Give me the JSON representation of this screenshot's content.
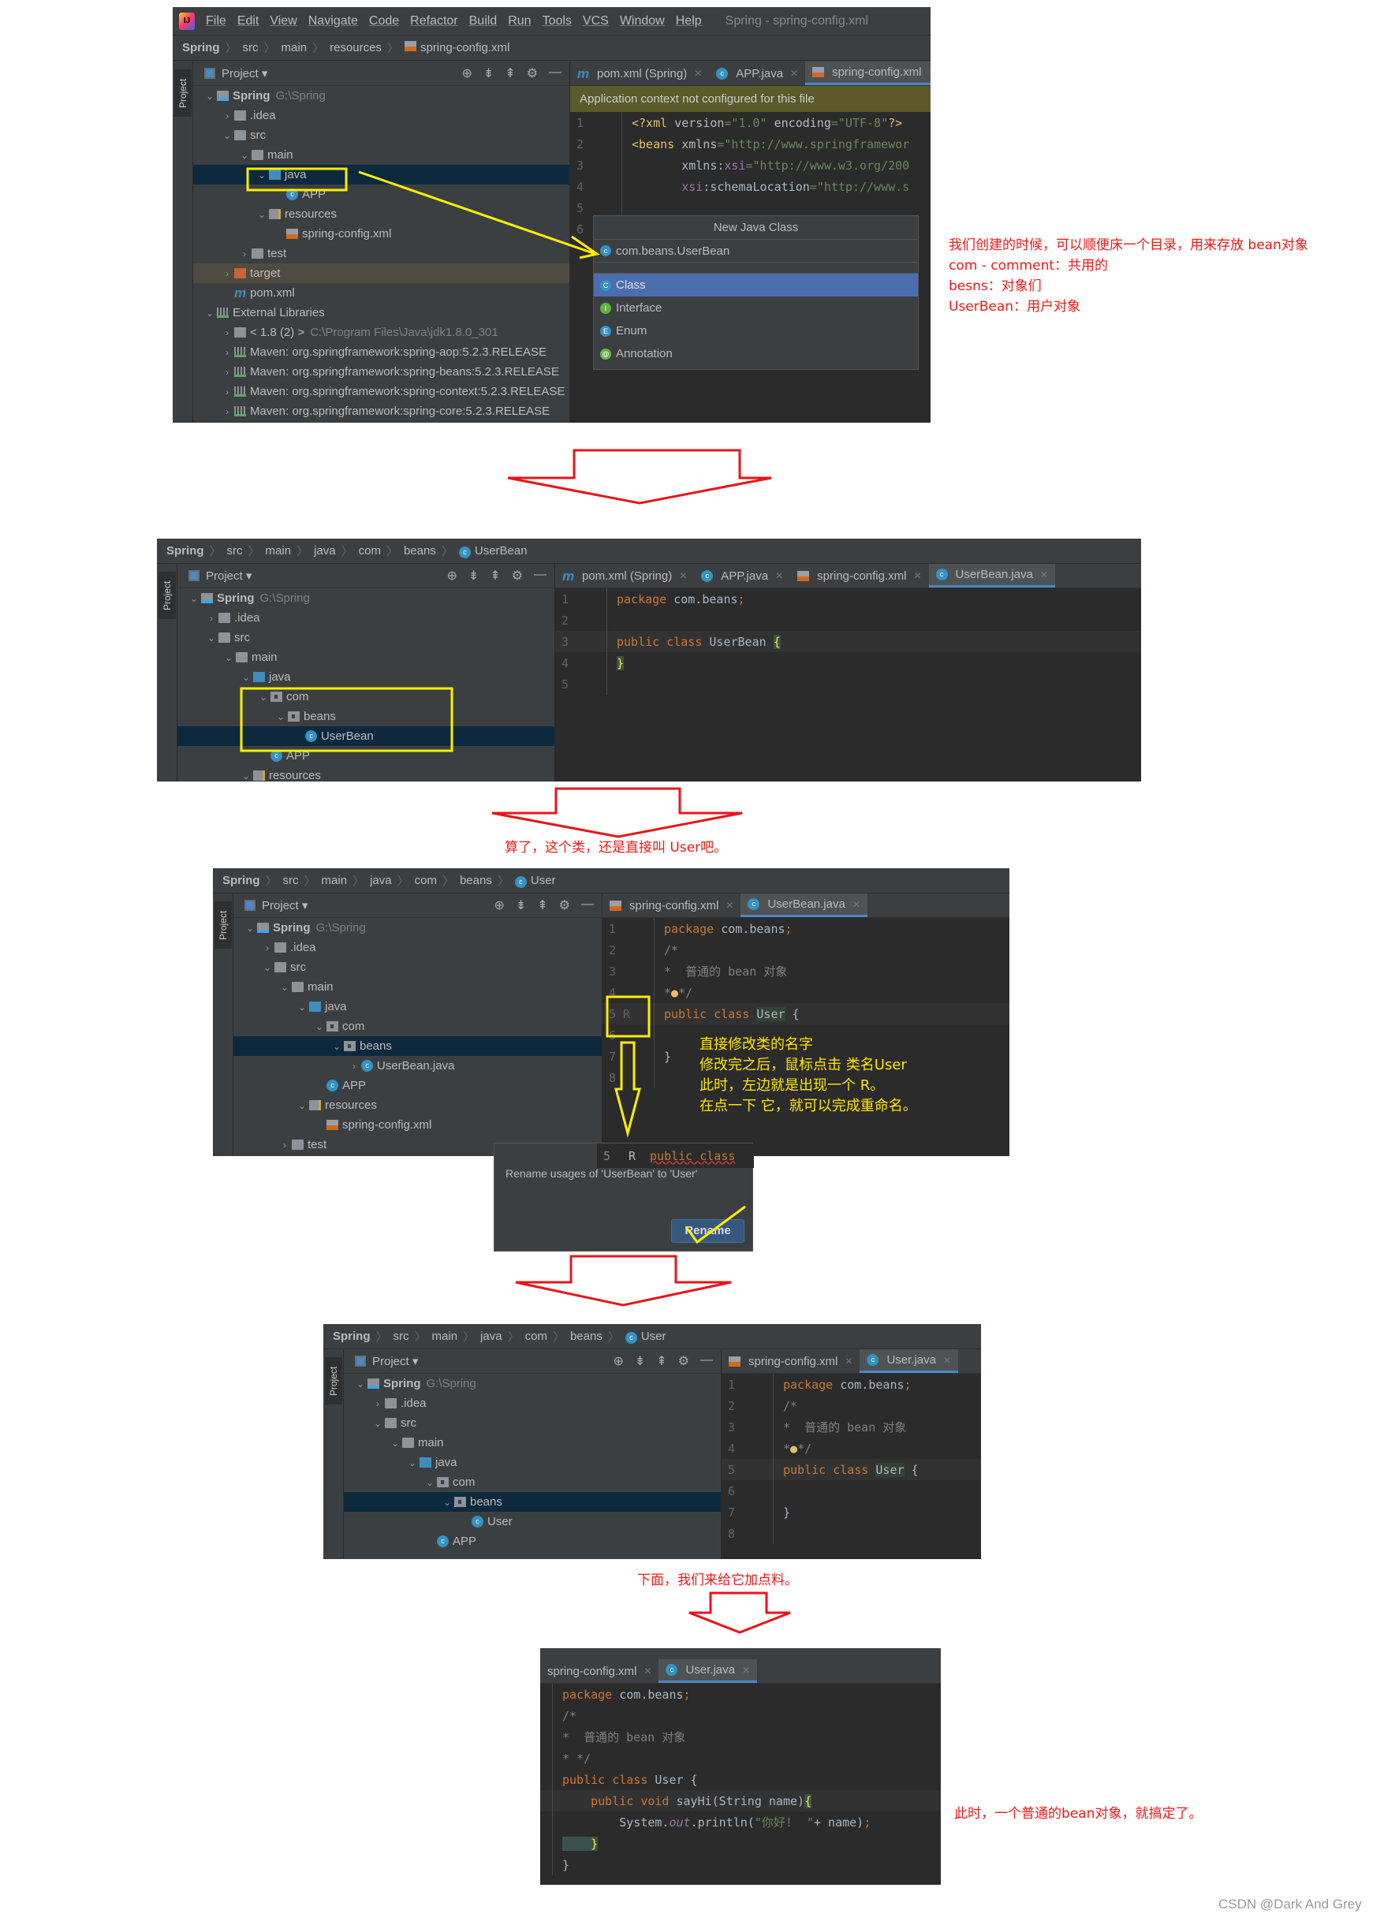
{
  "panel1": {
    "menu": [
      "File",
      "Edit",
      "View",
      "Navigate",
      "Code",
      "Refactor",
      "Build",
      "Run",
      "Tools",
      "VCS",
      "Window",
      "Help"
    ],
    "window_title": "Spring - spring-config.xml",
    "breadcrumb": [
      "Spring",
      "src",
      "main",
      "resources",
      "spring-config.xml"
    ],
    "project_label": "Project",
    "sidebar_label": "Project",
    "tree": [
      {
        "label": "Spring",
        "extra": "G:\\Spring",
        "depth": 0,
        "arrow": "open",
        "icon": "proj",
        "bold": true
      },
      {
        "label": ".idea",
        "depth": 1,
        "arrow": "closed",
        "icon": "folder"
      },
      {
        "label": "src",
        "depth": 1,
        "arrow": "open",
        "icon": "folder"
      },
      {
        "label": "main",
        "depth": 2,
        "arrow": "open",
        "icon": "folder"
      },
      {
        "label": "java",
        "depth": 3,
        "arrow": "open",
        "icon": "src",
        "selected": true
      },
      {
        "label": "APP",
        "depth": 4,
        "arrow": "none",
        "icon": "cls"
      },
      {
        "label": "resources",
        "depth": 3,
        "arrow": "open",
        "icon": "res"
      },
      {
        "label": "spring-config.xml",
        "depth": 4,
        "arrow": "none",
        "icon": "xml"
      },
      {
        "label": "test",
        "depth": 2,
        "arrow": "closed",
        "icon": "folder"
      },
      {
        "label": "target",
        "depth": 1,
        "arrow": "closed",
        "icon": "orange",
        "target": true
      },
      {
        "label": "pom.xml",
        "depth": 1,
        "arrow": "none",
        "icon": "mvn"
      },
      {
        "label": "External Libraries",
        "depth": 0,
        "arrow": "open",
        "icon": "lib"
      },
      {
        "label": "< 1.8 (2) >",
        "extra": "C:\\Program Files\\Java\\jdk1.8.0_301",
        "depth": 1,
        "arrow": "closed",
        "icon": "folder"
      },
      {
        "label": "Maven: org.springframework:spring-aop:5.2.3.RELEASE",
        "depth": 1,
        "arrow": "closed",
        "icon": "lib"
      },
      {
        "label": "Maven: org.springframework:spring-beans:5.2.3.RELEASE",
        "depth": 1,
        "arrow": "closed",
        "icon": "lib"
      },
      {
        "label": "Maven: org.springframework:spring-context:5.2.3.RELEASE",
        "depth": 1,
        "arrow": "closed",
        "icon": "lib"
      },
      {
        "label": "Maven: org.springframework:spring-core:5.2.3.RELEASE",
        "depth": 1,
        "arrow": "closed",
        "icon": "lib"
      }
    ],
    "tabs": [
      {
        "label": "pom.xml (Spring)",
        "icon": "mvn"
      },
      {
        "label": "APP.java",
        "icon": "cls"
      },
      {
        "label": "spring-config.xml",
        "icon": "xml",
        "active": true
      }
    ],
    "notification": "Application context not configured for this file",
    "code": [
      {
        "n": "1",
        "tokens": [
          [
            "t",
            "<?xml "
          ],
          [
            "a",
            "version"
          ],
          [
            "s",
            "=\"1.0\" "
          ],
          [
            "a",
            "encoding"
          ],
          [
            "s",
            "=\"UTF-8\""
          ],
          [
            "t",
            "?>"
          ]
        ]
      },
      {
        "n": "2",
        "tokens": [
          [
            "t",
            "<beans "
          ],
          [
            "a",
            "xmlns"
          ],
          [
            "s",
            "=\"http://www.springframewor"
          ]
        ]
      },
      {
        "n": "3",
        "tokens": [
          [
            "m",
            "       xmlns:"
          ],
          [
            "at",
            "xsi"
          ],
          [
            "s",
            "=\"http://www.w3.org/200"
          ]
        ]
      },
      {
        "n": "4",
        "tokens": [
          [
            "at",
            "       xsi"
          ],
          [
            "m",
            ":schemaLocation"
          ],
          [
            "s",
            "=\"http://www.s"
          ]
        ]
      },
      {
        "n": "5",
        "tokens": []
      },
      {
        "n": "6",
        "tokens": []
      }
    ],
    "popup": {
      "title": "New Java Class",
      "input_value": "com.beans.UserBean",
      "options": [
        {
          "label": "Class",
          "glyph": "C",
          "color": "#3592c4",
          "selected": true
        },
        {
          "label": "Interface",
          "glyph": "I",
          "color": "#62b543"
        },
        {
          "label": "Enum",
          "glyph": "E",
          "color": "#3592c4"
        },
        {
          "label": "Annotation",
          "glyph": "@",
          "color": "#62b543"
        }
      ]
    }
  },
  "note1": [
    "我们创建的时候，可以顺便床一个目录，用来存放 bean对象",
    "com - comment：共用的",
    "besns：对象们",
    "UserBean：用户对象"
  ],
  "panel2": {
    "breadcrumb": [
      "Spring",
      "src",
      "main",
      "java",
      "com",
      "beans",
      "UserBean"
    ],
    "project_label": "Project",
    "sidebar_label": "Project",
    "tree": [
      {
        "label": "Spring",
        "extra": "G:\\Spring",
        "depth": 0,
        "arrow": "open",
        "icon": "proj",
        "bold": true
      },
      {
        "label": ".idea",
        "depth": 1,
        "arrow": "closed",
        "icon": "folder"
      },
      {
        "label": "src",
        "depth": 1,
        "arrow": "open",
        "icon": "folder"
      },
      {
        "label": "main",
        "depth": 2,
        "arrow": "open",
        "icon": "folder"
      },
      {
        "label": "java",
        "depth": 3,
        "arrow": "open",
        "icon": "src"
      },
      {
        "label": "com",
        "depth": 4,
        "arrow": "open",
        "icon": "pkg"
      },
      {
        "label": "beans",
        "depth": 5,
        "arrow": "open",
        "icon": "pkg"
      },
      {
        "label": "UserBean",
        "depth": 6,
        "arrow": "none",
        "icon": "cls",
        "selected": true
      },
      {
        "label": "APP",
        "depth": 4,
        "arrow": "none",
        "icon": "cls"
      },
      {
        "label": "resources",
        "depth": 3,
        "arrow": "open",
        "icon": "res"
      }
    ],
    "tabs": [
      {
        "label": "pom.xml (Spring)",
        "icon": "mvn"
      },
      {
        "label": "APP.java",
        "icon": "cls"
      },
      {
        "label": "spring-config.xml",
        "icon": "xml"
      },
      {
        "label": "UserBean.java",
        "icon": "cls",
        "active": true
      }
    ],
    "code": [
      {
        "n": "1",
        "tokens": [
          [
            "k",
            "package "
          ],
          [
            "m",
            "com.beans"
          ],
          [
            "k",
            ";"
          ]
        ]
      },
      {
        "n": "2",
        "tokens": []
      },
      {
        "n": "3",
        "cur": true,
        "tokens": [
          [
            "k",
            "public class "
          ],
          [
            "m",
            "UserBean "
          ],
          [
            "br",
            "{"
          ]
        ]
      },
      {
        "n": "4",
        "tokens": [
          [
            "br",
            "}"
          ]
        ]
      },
      {
        "n": "5",
        "tokens": []
      }
    ]
  },
  "caption2": "算了，这个类，还是直接叫 User吧。",
  "panel3": {
    "breadcrumb": [
      "Spring",
      "src",
      "main",
      "java",
      "com",
      "beans",
      "User"
    ],
    "project_label": "Project",
    "sidebar_label": "Project",
    "tree": [
      {
        "label": "Spring",
        "extra": "G:\\Spring",
        "depth": 0,
        "arrow": "open",
        "icon": "proj",
        "bold": true
      },
      {
        "label": ".idea",
        "depth": 1,
        "arrow": "closed",
        "icon": "folder"
      },
      {
        "label": "src",
        "depth": 1,
        "arrow": "open",
        "icon": "folder"
      },
      {
        "label": "main",
        "depth": 2,
        "arrow": "open",
        "icon": "folder"
      },
      {
        "label": "java",
        "depth": 3,
        "arrow": "open",
        "icon": "src"
      },
      {
        "label": "com",
        "depth": 4,
        "arrow": "open",
        "icon": "pkg"
      },
      {
        "label": "beans",
        "depth": 5,
        "arrow": "open",
        "icon": "pkg",
        "selected": true
      },
      {
        "label": "UserBean.java",
        "depth": 6,
        "arrow": "closed",
        "icon": "cls"
      },
      {
        "label": "APP",
        "depth": 4,
        "arrow": "none",
        "icon": "cls"
      },
      {
        "label": "resources",
        "depth": 3,
        "arrow": "open",
        "icon": "res"
      },
      {
        "label": "spring-config.xml",
        "depth": 4,
        "arrow": "none",
        "icon": "xml"
      },
      {
        "label": "test",
        "depth": 2,
        "arrow": "closed",
        "icon": "folder"
      }
    ],
    "tabs": [
      {
        "label": "spring-config.xml",
        "icon": "xml"
      },
      {
        "label": "UserBean.java",
        "icon": "cls",
        "active": true
      }
    ],
    "code": [
      {
        "n": "1",
        "tokens": [
          [
            "k",
            "package "
          ],
          [
            "m",
            "com.beans"
          ],
          [
            "k",
            ";"
          ]
        ]
      },
      {
        "n": "2",
        "tokens": [
          [
            "cm",
            "/*"
          ]
        ]
      },
      {
        "n": "3",
        "tokens": [
          [
            "cm",
            "*  普通的 bean 对象"
          ]
        ]
      },
      {
        "n": "4",
        "tokens": [
          [
            "cm",
            "*"
          ],
          [
            "t",
            "●"
          ],
          [
            "cm",
            "*/"
          ]
        ]
      },
      {
        "n": "5 R",
        "cur": true,
        "tokens": [
          [
            "k",
            "public class "
          ],
          [
            "hl",
            "User"
          ],
          [
            "m",
            " {"
          ]
        ]
      },
      {
        "n": "6",
        "tokens": []
      },
      {
        "n": "7",
        "tokens": [
          [
            "m",
            "}"
          ]
        ]
      },
      {
        "n": "8",
        "tokens": []
      }
    ],
    "instructions": [
      "直接修改类的名字",
      "修改完之后，鼠标点击 类名User",
      "此时，左边就是出现一个 R。",
      "在点一下 它，就可以完成重命名。"
    ],
    "rename_popup": {
      "line": "5",
      "glyph": "R",
      "code_preview": "public class",
      "message": "Rename usages of 'UserBean' to 'User'",
      "button": "Rename"
    }
  },
  "panel4": {
    "breadcrumb": [
      "Spring",
      "src",
      "main",
      "java",
      "com",
      "beans",
      "User"
    ],
    "project_label": "Project",
    "sidebar_label": "Project",
    "tree": [
      {
        "label": "Spring",
        "extra": "G:\\Spring",
        "depth": 0,
        "arrow": "open",
        "icon": "proj",
        "bold": true
      },
      {
        "label": ".idea",
        "depth": 1,
        "arrow": "closed",
        "icon": "folder"
      },
      {
        "label": "src",
        "depth": 1,
        "arrow": "open",
        "icon": "folder"
      },
      {
        "label": "main",
        "depth": 2,
        "arrow": "open",
        "icon": "folder"
      },
      {
        "label": "java",
        "depth": 3,
        "arrow": "open",
        "icon": "src"
      },
      {
        "label": "com",
        "depth": 4,
        "arrow": "open",
        "icon": "pkg"
      },
      {
        "label": "beans",
        "depth": 5,
        "arrow": "open",
        "icon": "pkg",
        "selected": true
      },
      {
        "label": "User",
        "depth": 6,
        "arrow": "none",
        "icon": "cls"
      },
      {
        "label": "APP",
        "depth": 4,
        "arrow": "none",
        "icon": "cls"
      }
    ],
    "tabs": [
      {
        "label": "spring-config.xml",
        "icon": "xml"
      },
      {
        "label": "User.java",
        "icon": "cls",
        "active": true
      }
    ],
    "code": [
      {
        "n": "1",
        "tokens": [
          [
            "k",
            "package "
          ],
          [
            "m",
            "com.beans"
          ],
          [
            "k",
            ";"
          ]
        ]
      },
      {
        "n": "2",
        "tokens": [
          [
            "cm",
            "/*"
          ]
        ]
      },
      {
        "n": "3",
        "tokens": [
          [
            "cm",
            "*  普通的 bean 对象"
          ]
        ]
      },
      {
        "n": "4",
        "tokens": [
          [
            "cm",
            "*"
          ],
          [
            "t",
            "●"
          ],
          [
            "cm",
            "*/"
          ]
        ]
      },
      {
        "n": "5",
        "cur": true,
        "tokens": [
          [
            "k",
            "public class "
          ],
          [
            "hl",
            "User"
          ],
          [
            "m",
            " {"
          ]
        ]
      },
      {
        "n": "6",
        "tokens": []
      },
      {
        "n": "7",
        "tokens": [
          [
            "m",
            "}"
          ]
        ]
      },
      {
        "n": "8",
        "tokens": []
      }
    ]
  },
  "caption4": "下面，我们来给它加点料。",
  "panel5": {
    "tabs": [
      {
        "label": "spring-config.xml",
        "icon": "none"
      },
      {
        "label": "User.java",
        "icon": "cls",
        "active": true
      }
    ],
    "code": [
      {
        "n": "",
        "tokens": [
          [
            "k",
            "package "
          ],
          [
            "m",
            "com.beans"
          ],
          [
            "k",
            ";"
          ]
        ]
      },
      {
        "n": "",
        "tokens": [
          [
            "cm",
            "/*"
          ]
        ]
      },
      {
        "n": "",
        "tokens": [
          [
            "cm",
            "*  普通的 bean 对象"
          ]
        ]
      },
      {
        "n": "",
        "tokens": [
          [
            "cm",
            "* */"
          ]
        ]
      },
      {
        "n": "",
        "tokens": [
          [
            "k",
            "public class "
          ],
          [
            "m",
            "User {"
          ]
        ]
      },
      {
        "n": "",
        "cur": true,
        "tokens": [
          [
            "k",
            "    public void "
          ],
          [
            "m",
            "sayHi(String name)"
          ],
          [
            "br",
            "{"
          ]
        ]
      },
      {
        "n": "",
        "tokens": [
          [
            "m",
            "        System."
          ],
          [
            "fld",
            "out"
          ],
          [
            "m",
            ".println("
          ],
          [
            "s",
            "\"你好!  \""
          ],
          [
            "m",
            "+ name)"
          ],
          [
            "k",
            ";"
          ]
        ]
      },
      {
        "n": "",
        "tokens": [
          [
            "br",
            "    }"
          ]
        ]
      },
      {
        "n": "",
        "tokens": [
          [
            "m",
            "}"
          ]
        ]
      }
    ]
  },
  "caption5": "此时，一个普通的bean对象，就搞定了。",
  "watermark": "CSDN @Dark And Grey",
  "colors": {
    "annotation_red": "#f01818",
    "highlight_yellow": "#ffe400",
    "selection": "#0d293e",
    "tab_underline": "#4a88c7"
  }
}
